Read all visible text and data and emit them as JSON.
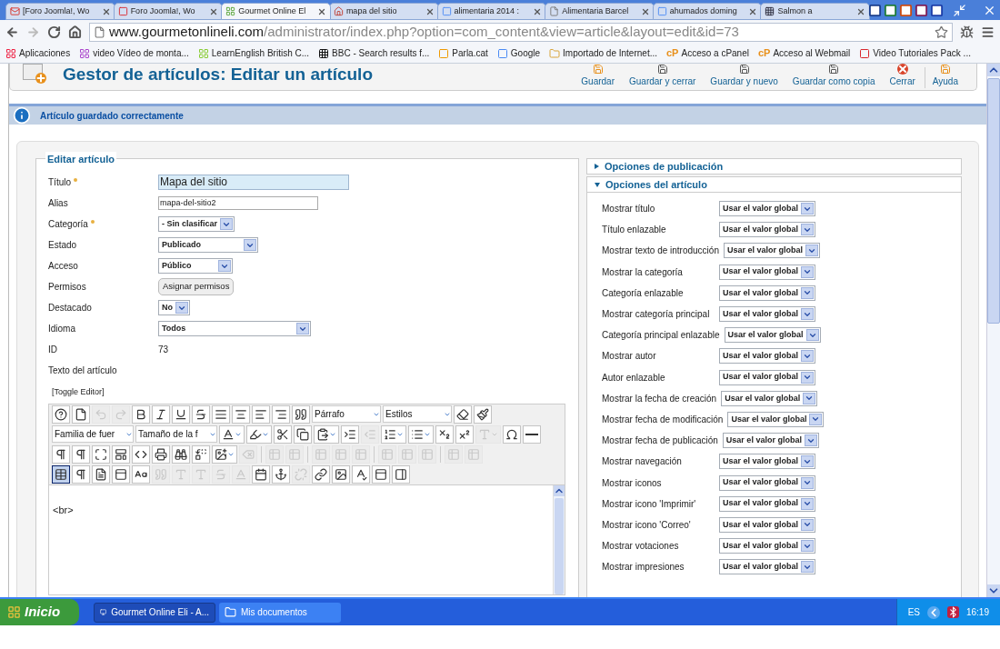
{
  "browser": {
    "tabs": [
      {
        "title": "[Foro Joomla!, Wo",
        "selected": false
      },
      {
        "title": "Foro Joomla!, Wo",
        "selected": false
      },
      {
        "title": "Gourmet Online El",
        "selected": true
      },
      {
        "title": "mapa del sitio",
        "selected": false
      },
      {
        "title": "alimentaria 2014 :",
        "selected": false
      },
      {
        "title": "Alimentaria Barcel",
        "selected": false
      },
      {
        "title": "ahumados doming",
        "selected": false
      },
      {
        "title": "Salmon a",
        "selected": false
      }
    ],
    "address": {
      "domain": "www.gourmetonlineli.com",
      "path": "/administrator/index.php?option=com_content&view=article&layout=edit&id=73"
    },
    "bookmarks": [
      {
        "label": "Aplicaciones"
      },
      {
        "label": "video Vídeo de monta..."
      },
      {
        "label": "LearnEnglish  British C..."
      },
      {
        "label": "BBC - Search results f..."
      },
      {
        "label": "Parla.cat"
      },
      {
        "label": "Google"
      },
      {
        "label": "Importado de Internet..."
      },
      {
        "label": "Acceso a cPanel",
        "logo": "cP"
      },
      {
        "label": "Acceso al Webmail",
        "logo": "cP"
      },
      {
        "label": "Video Tutoriales Pack ..."
      }
    ]
  },
  "page": {
    "title": "Gestor de artículos: Editar un artículo",
    "toolbar": [
      "Guardar",
      "Guardar y cerrar",
      "Guardar y nuevo",
      "Guardar como copia",
      "Cerrar",
      "Ayuda"
    ],
    "message": "Artículo guardado correctamente",
    "form": {
      "legend": "Editar artículo",
      "fields": [
        {
          "label": "Título",
          "required": true,
          "kind": "title",
          "value": "Mapa del sitio"
        },
        {
          "label": "Alias",
          "required": false,
          "kind": "text",
          "value": "mapa-del-sitio2"
        },
        {
          "label": "Categoría",
          "required": true,
          "kind": "select",
          "value": "- Sin clasificar"
        },
        {
          "label": "Estado",
          "required": false,
          "kind": "select",
          "value": "Publicado"
        },
        {
          "label": "Acceso",
          "required": false,
          "kind": "select",
          "value": "Público"
        },
        {
          "label": "Permisos",
          "required": false,
          "kind": "button",
          "value": "Asignar permisos"
        },
        {
          "label": "Destacado",
          "required": false,
          "kind": "select",
          "value": "No"
        },
        {
          "label": "Idioma",
          "required": false,
          "kind": "select",
          "value": "Todos"
        },
        {
          "label": "ID",
          "required": false,
          "kind": "static",
          "value": "73"
        },
        {
          "label": "Texto del artículo",
          "required": false,
          "kind": "none"
        }
      ],
      "toggle": "[Toggle Editor]",
      "editor": {
        "rows": [
          [
            {
              "kind": "button",
              "disabled": false
            },
            {
              "kind": "button",
              "disabled": false
            },
            {
              "kind": "button",
              "disabled": true
            },
            {
              "kind": "button",
              "disabled": true
            },
            {
              "kind": "button",
              "disabled": false
            },
            {
              "kind": "button",
              "disabled": false
            },
            {
              "kind": "button",
              "disabled": false
            },
            {
              "kind": "button",
              "disabled": false
            },
            {
              "kind": "button",
              "disabled": false
            },
            {
              "kind": "button",
              "disabled": false
            },
            {
              "kind": "button",
              "disabled": false
            },
            {
              "kind": "button",
              "disabled": false
            },
            {
              "kind": "button",
              "disabled": false
            },
            {
              "kind": "select",
              "value": "Párrafo"
            },
            {
              "kind": "select",
              "value": "Estilos"
            },
            {
              "kind": "button",
              "disabled": false
            },
            {
              "kind": "button",
              "disabled": false
            }
          ],
          [
            {
              "kind": "select",
              "value": "Familia de fuer"
            },
            {
              "kind": "select",
              "value": "Tamaño de la f"
            },
            {
              "kind": "menu",
              "disabled": false
            },
            {
              "kind": "menu",
              "disabled": false
            },
            {
              "kind": "button",
              "disabled": false
            },
            {
              "kind": "button",
              "disabled": false
            },
            {
              "kind": "menu",
              "disabled": false
            },
            {
              "kind": "button",
              "disabled": false
            },
            {
              "kind": "button",
              "disabled": true
            },
            {
              "kind": "menu",
              "disabled": false
            },
            {
              "kind": "menu",
              "disabled": false
            },
            {
              "kind": "button",
              "disabled": false
            },
            {
              "kind": "button",
              "disabled": false
            },
            {
              "kind": "menu",
              "disabled": true
            },
            {
              "kind": "button",
              "disabled": false
            },
            {
              "kind": "button",
              "disabled": false
            }
          ],
          [
            {
              "kind": "button",
              "disabled": false
            },
            {
              "kind": "button",
              "disabled": false
            },
            {
              "kind": "button",
              "disabled": false
            },
            {
              "kind": "button",
              "disabled": false
            },
            {
              "kind": "button",
              "disabled": false
            },
            {
              "kind": "button",
              "disabled": false
            },
            {
              "kind": "button",
              "disabled": false
            },
            {
              "kind": "button",
              "disabled": false
            },
            {
              "kind": "menu",
              "disabled": false
            },
            {
              "kind": "button",
              "disabled": true
            },
            {
              "kind": "separator"
            },
            {
              "kind": "button",
              "disabled": true
            },
            {
              "kind": "button",
              "disabled": true
            },
            {
              "kind": "separator"
            },
            {
              "kind": "button",
              "disabled": true
            },
            {
              "kind": "button",
              "disabled": true
            },
            {
              "kind": "button",
              "disabled": true
            },
            {
              "kind": "separator"
            },
            {
              "kind": "button",
              "disabled": true
            },
            {
              "kind": "button",
              "disabled": true
            },
            {
              "kind": "button",
              "disabled": true
            },
            {
              "kind": "separator"
            },
            {
              "kind": "button",
              "disabled": true
            },
            {
              "kind": "button",
              "disabled": true
            }
          ],
          [
            {
              "kind": "button",
              "disabled": false,
              "selected": true
            },
            {
              "kind": "button",
              "disabled": false
            },
            {
              "kind": "button",
              "disabled": false
            },
            {
              "kind": "button",
              "disabled": false
            },
            {
              "kind": "button",
              "disabled": false
            },
            {
              "kind": "button",
              "disabled": true
            },
            {
              "kind": "button",
              "disabled": true
            },
            {
              "kind": "button",
              "disabled": true
            },
            {
              "kind": "button",
              "disabled": true
            },
            {
              "kind": "button",
              "disabled": true
            },
            {
              "kind": "button",
              "disabled": false
            },
            {
              "kind": "button",
              "disabled": false
            },
            {
              "kind": "button",
              "disabled": true
            },
            {
              "kind": "button",
              "disabled": false
            },
            {
              "kind": "button",
              "disabled": false
            },
            {
              "kind": "button",
              "disabled": false
            },
            {
              "kind": "button",
              "disabled": false
            },
            {
              "kind": "button",
              "disabled": false
            }
          ]
        ],
        "content": "<br>"
      }
    },
    "options": {
      "panels": [
        {
          "title": "Opciones de publicación",
          "expanded": false
        },
        {
          "title": "Opciones del artículo",
          "expanded": true
        }
      ],
      "rows": [
        {
          "label": "Mostrar título",
          "value": "Usar el valor global"
        },
        {
          "label": "Título enlazable",
          "value": "Usar el valor global"
        },
        {
          "label": "Mostrar texto de introducción",
          "value": "Usar el valor global"
        },
        {
          "label": "Mostrar la categoría",
          "value": "Usar el valor global"
        },
        {
          "label": "Categoría enlazable",
          "value": "Usar el valor global"
        },
        {
          "label": "Mostrar categoría principal",
          "value": "Usar el valor global"
        },
        {
          "label": "Categoría principal enlazable",
          "value": "Usar el valor global"
        },
        {
          "label": "Mostrar autor",
          "value": "Usar el valor global"
        },
        {
          "label": "Autor enlazable",
          "value": "Usar el valor global"
        },
        {
          "label": "Mostrar la fecha de creación",
          "value": "Usar el valor global"
        },
        {
          "label": "Mostrar fecha de modificación",
          "value": "Usar el valor global"
        },
        {
          "label": "Mostrar fecha de publicación",
          "value": "Usar el valor global"
        },
        {
          "label": "Mostrar navegación",
          "value": "Usar el valor global"
        },
        {
          "label": "Mostrar iconos",
          "value": "Usar el valor global"
        },
        {
          "label": "Mostrar icono 'Imprimir'",
          "value": "Usar el valor global"
        },
        {
          "label": "Mostrar icono 'Correo'",
          "value": "Usar el valor global"
        },
        {
          "label": "Mostrar votaciones",
          "value": "Usar el valor global"
        },
        {
          "label": "Mostrar impresiones",
          "value": "Usar el valor global"
        }
      ]
    }
  },
  "taskbar": {
    "start": "Inicio",
    "tasks": [
      {
        "label": "Gourmet Online Eli - A...",
        "selected": true
      },
      {
        "label": "Mis documentos",
        "selected": false
      }
    ],
    "language": "ES",
    "time": "16:19"
  }
}
